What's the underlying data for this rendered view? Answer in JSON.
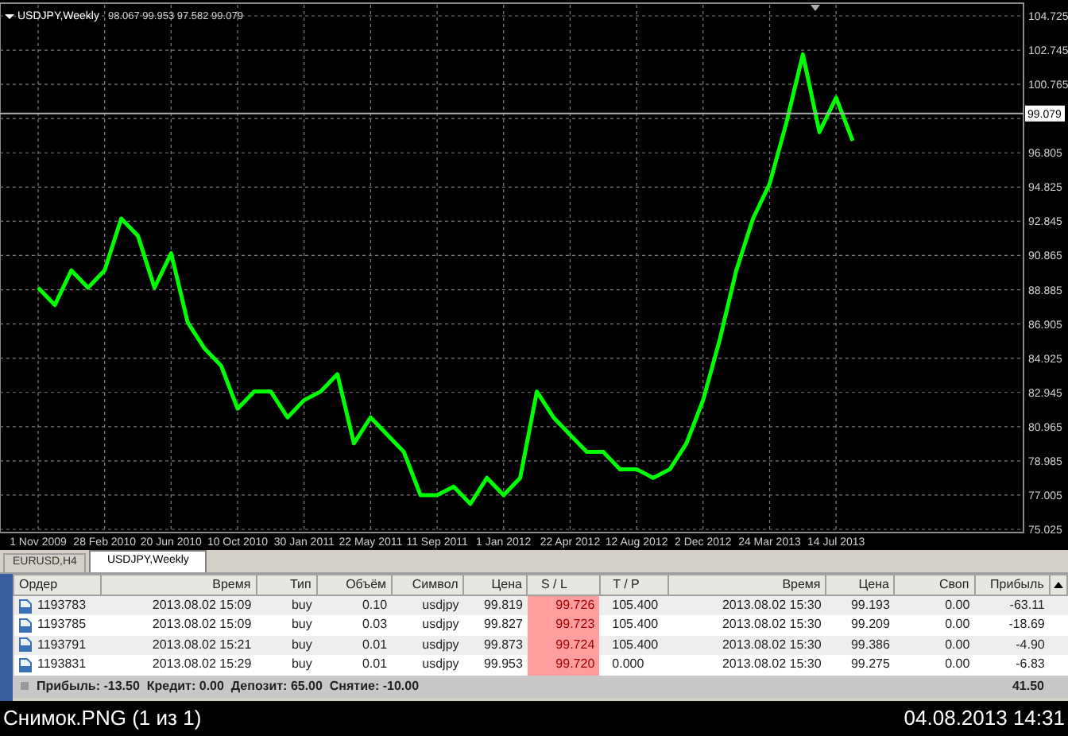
{
  "chart": {
    "header": "USDJPY,Weekly",
    "ohlc": "98.067 99.953 97.582 99.079",
    "chart_data": {
      "type": "line",
      "categories": [
        "1 Nov 2009",
        null,
        null,
        null,
        "28 Feb 2010",
        null,
        null,
        null,
        "20 Jun 2010",
        null,
        null,
        null,
        "10 Oct 2010",
        null,
        null,
        null,
        "30 Jan 2011",
        null,
        null,
        null,
        "22 May 2011",
        null,
        null,
        null,
        "11 Sep 2011",
        null,
        null,
        null,
        "1 Jan 2012",
        null,
        null,
        null,
        "22 Apr 2012",
        null,
        null,
        null,
        "12 Aug 2012",
        null,
        null,
        null,
        "2 Dec 2012",
        null,
        null,
        null,
        "24 Mar 2013",
        null,
        null,
        null,
        "14 Jul 2013",
        null
      ],
      "series": [
        {
          "color": "#00ff00",
          "values": [
            89,
            88,
            90,
            89,
            90,
            93,
            92,
            89,
            91,
            87,
            85.5,
            84.5,
            82,
            83,
            83,
            81.5,
            82.5,
            83,
            84,
            80,
            81.5,
            80.5,
            79.5,
            77,
            77,
            77.5,
            76.5,
            78,
            77,
            78,
            83,
            81.5,
            80.5,
            79.5,
            79.5,
            78.5,
            78.5,
            78,
            78.5,
            80,
            82.5,
            86,
            90,
            93,
            95,
            98.5,
            102.5,
            98,
            100,
            97.5
          ]
        }
      ],
      "ylim": [
        75.025,
        104.725
      ],
      "grid": true,
      "ref_lines": [
        {
          "axis": "y",
          "value": 99.079,
          "label": "99.079"
        }
      ],
      "yticks": [
        {
          "value": 104.725,
          "label": "104.725"
        },
        {
          "value": 102.745,
          "label": "102.745"
        },
        {
          "value": 100.765,
          "label": "100.765"
        },
        {
          "value": 96.805,
          "label": "96.805"
        },
        {
          "value": 94.825,
          "label": "94.825"
        },
        {
          "value": 92.845,
          "label": "92.845"
        },
        {
          "value": 90.865,
          "label": "90.865"
        },
        {
          "value": 88.885,
          "label": "88.885"
        },
        {
          "value": 86.905,
          "label": "86.905"
        },
        {
          "value": 84.925,
          "label": "84.925"
        },
        {
          "value": 82.945,
          "label": "82.945"
        },
        {
          "value": 80.965,
          "label": "80.965"
        },
        {
          "value": 78.985,
          "label": "78.985"
        },
        {
          "value": 77.005,
          "label": "77.005"
        },
        {
          "value": 75.025,
          "label": "75.025"
        }
      ]
    }
  },
  "tabs": [
    {
      "label": "EURUSD,H4",
      "selected": false
    },
    {
      "label": "USDJPY,Weekly",
      "selected": true
    }
  ],
  "table": {
    "columns": [
      "Ордер",
      "Время",
      "Тип",
      "Объём",
      "Символ",
      "Цена",
      "S / L",
      "T / P",
      "Время",
      "Цена",
      "Своп",
      "Прибыль"
    ],
    "rows": [
      [
        "1193783",
        "2013.08.02 15:09",
        "buy",
        "0.10",
        "usdjpy",
        "99.819",
        "99.726",
        "105.400",
        "2013.08.02 15:30",
        "99.193",
        "0.00",
        "-63.11"
      ],
      [
        "1193785",
        "2013.08.02 15:09",
        "buy",
        "0.03",
        "usdjpy",
        "99.827",
        "99.723",
        "105.400",
        "2013.08.02 15:30",
        "99.209",
        "0.00",
        "-18.69"
      ],
      [
        "1193791",
        "2013.08.02 15:21",
        "buy",
        "0.01",
        "usdjpy",
        "99.873",
        "99.724",
        "105.400",
        "2013.08.02 15:30",
        "99.386",
        "0.00",
        "-4.90"
      ],
      [
        "1193831",
        "2013.08.02 15:29",
        "buy",
        "0.01",
        "usdjpy",
        "99.953",
        "99.720",
        "0.000",
        "2013.08.02 15:30",
        "99.275",
        "0.00",
        "-6.83"
      ]
    ],
    "summary": "Прибыль: -13.50  Кредит: 0.00  Депозит: 65.00  Снятие: -10.00",
    "summary_total": "41.50"
  },
  "status_bar": {
    "file": "Снимок.PNG (1 из 1)",
    "datetime": "04.08.2013 14:31"
  }
}
